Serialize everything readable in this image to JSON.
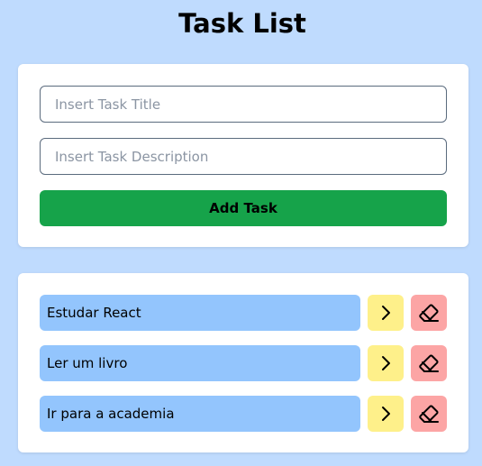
{
  "page": {
    "title": "Task List"
  },
  "form": {
    "title_placeholder": "Insert Task Title",
    "title_value": "",
    "description_placeholder": "Insert Task Description",
    "description_value": "",
    "add_label": "Add Task"
  },
  "tasks": [
    {
      "title": "Estudar React",
      "details_icon": "chevron-right-icon",
      "delete_icon": "eraser-icon"
    },
    {
      "title": "Ler um livro",
      "details_icon": "chevron-right-icon",
      "delete_icon": "eraser-icon"
    },
    {
      "title": "Ir para a academia",
      "details_icon": "chevron-right-icon",
      "delete_icon": "eraser-icon"
    }
  ],
  "colors": {
    "background": "#bfdbfe",
    "card": "#ffffff",
    "add_button": "#16a34a",
    "task_item": "#93c5fd",
    "details_button": "#fef08a",
    "delete_button": "#fca5a5"
  }
}
